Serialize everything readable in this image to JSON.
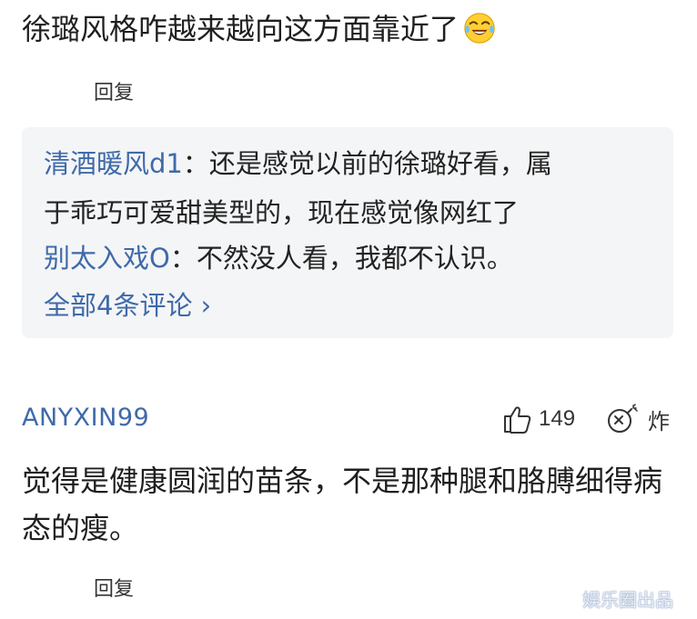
{
  "top_comment": {
    "text": "徐璐风格咋越来越向这方面靠近了",
    "emoji": "crying-laughing-emoji",
    "reply_label": "回复"
  },
  "sub_comments": [
    {
      "user": "清酒暖风d1",
      "sep": "：",
      "text_line1": "还是感觉以前的徐璐好看，属",
      "text_line2": "于乖巧可爱甜美型的，现在感觉像网红了"
    },
    {
      "user": "别太入戏O",
      "sep": "：",
      "text_line1": "不然没人看，我都不认识。"
    }
  ],
  "all_comments_label": "全部4条评论 ›",
  "comment": {
    "username": "ANYXIN99",
    "likes": "149",
    "bomb_label": "炸",
    "text": "觉得是健康圆润的苗条，不是那种腿和胳膊细得病态的瘦。",
    "reply_label": "回复"
  },
  "watermark": "娱乐圈出品",
  "colors": {
    "link_blue": "#3f6aa8",
    "sub_box_bg": "#f4f5f7",
    "text_dark": "#1f1f1f"
  },
  "icons": [
    "thumbs-up-icon",
    "bomb-icon"
  ]
}
